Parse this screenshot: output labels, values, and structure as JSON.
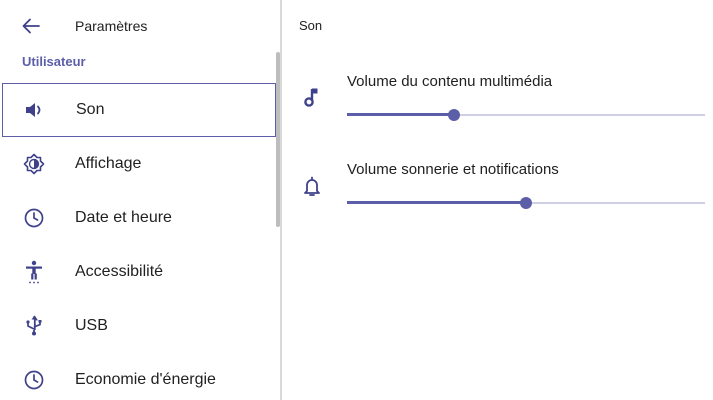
{
  "nav": {
    "back_icon": "arrow-left-icon",
    "title": "Paramètres",
    "section": "Utilisateur",
    "items": [
      {
        "label": "Son",
        "icon": "volume-icon",
        "selected": true
      },
      {
        "label": "Affichage",
        "icon": "brightness-icon",
        "selected": false
      },
      {
        "label": "Date et heure",
        "icon": "clock-icon",
        "selected": false
      },
      {
        "label": "Accessibilité",
        "icon": "accessibility-icon",
        "selected": false
      },
      {
        "label": "USB",
        "icon": "usb-icon",
        "selected": false
      },
      {
        "label": "Economie d'énergie",
        "icon": "clock-icon",
        "selected": false
      }
    ]
  },
  "content": {
    "title": "Son",
    "settings": [
      {
        "label": "Volume du contenu multimédia",
        "icon": "music-note-icon",
        "level": 0.3
      },
      {
        "label": "Volume sonnerie et notifications",
        "icon": "bell-icon",
        "level": 0.5
      }
    ]
  },
  "colors": {
    "accent": "#5c5fa8",
    "track": "#cfcfe6",
    "icon": "#3f428a",
    "divider": "#d9d9d9"
  }
}
